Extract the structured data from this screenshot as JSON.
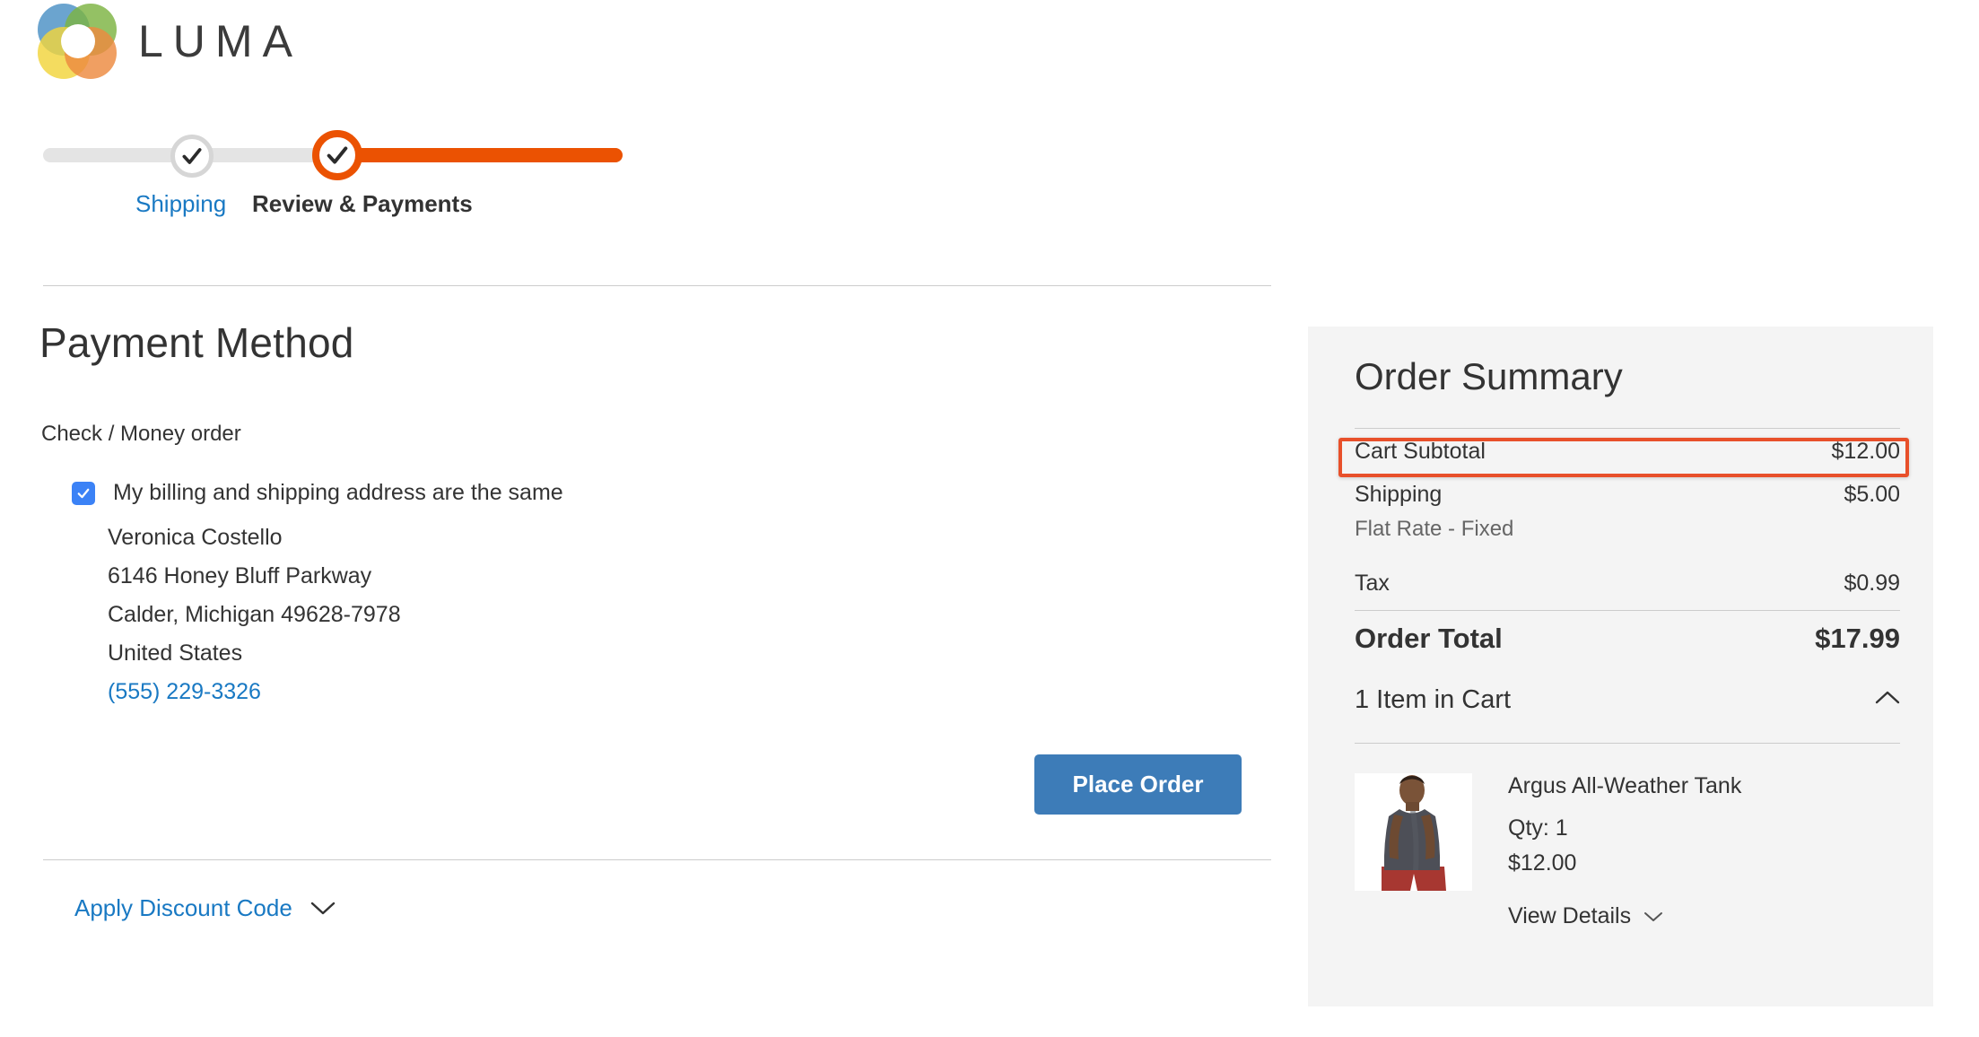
{
  "brand": {
    "name": "LUMA",
    "logo_icon": "luma-rings-logo"
  },
  "progress": {
    "steps": [
      {
        "label": "Shipping",
        "state": "completed",
        "icon": "check-icon",
        "color": "#1979c3"
      },
      {
        "label": "Review & Payments",
        "state": "current",
        "icon": "check-icon",
        "color": "#eb5202"
      }
    ]
  },
  "payment": {
    "heading": "Payment Method",
    "method": "Check / Money order",
    "billing_same_label": "My billing and shipping address are the same",
    "billing_same_checked": true,
    "address": {
      "name": "Veronica Costello",
      "street": "6146 Honey Bluff Parkway",
      "city_state_zip": "Calder, Michigan 49628-7978",
      "country": "United States",
      "phone": "(555) 229-3326"
    },
    "place_order_label": "Place Order",
    "discount_label": "Apply Discount Code",
    "discount_icon": "chevron-down-icon"
  },
  "summary": {
    "title": "Order Summary",
    "rows": [
      {
        "label": "Cart Subtotal",
        "value": "$12.00",
        "highlighted": true
      },
      {
        "label": "Shipping",
        "value": "$5.00",
        "sublabel": "Flat Rate - Fixed"
      },
      {
        "label": "Tax",
        "value": "$0.99"
      }
    ],
    "total": {
      "label": "Order Total",
      "value": "$17.99"
    },
    "cart_toggle": {
      "label": "1 Item in Cart",
      "icon": "chevron-up-icon",
      "expanded": true
    },
    "items": [
      {
        "name": "Argus All-Weather Tank",
        "qty": "Qty: 1",
        "price": "$12.00",
        "view_details": "View Details",
        "view_details_icon": "chevron-down-icon",
        "thumbnail": "product-photo-argus-tank"
      }
    ]
  },
  "annotation": {
    "color": "#e8502a",
    "target": "Cart Subtotal"
  }
}
